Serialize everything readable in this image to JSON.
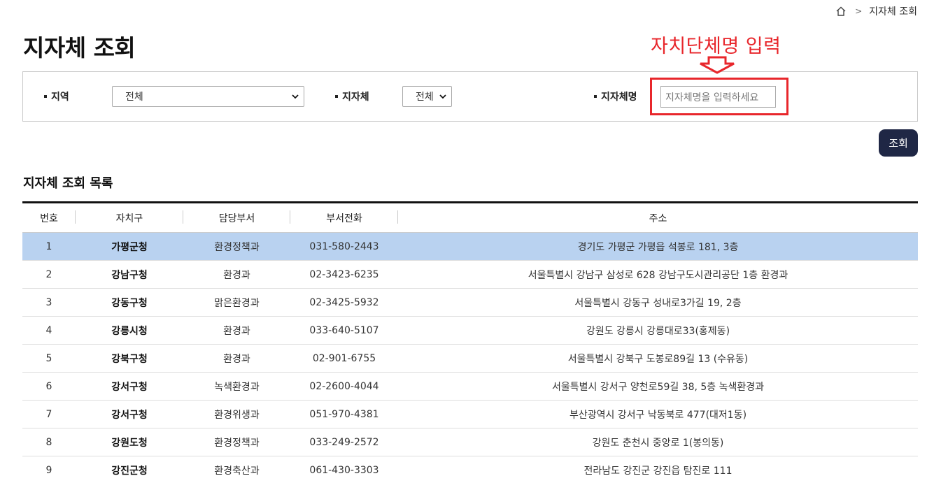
{
  "breadcrumb": {
    "home_icon": "home-icon",
    "separator": ">",
    "current": "지자체 조회"
  },
  "page": {
    "title": "지자체 조회"
  },
  "annotation": {
    "label": "자치단체명 입력",
    "color": "#e8262b"
  },
  "search": {
    "region_label": "지역",
    "region_value": "전체",
    "local_label": "지자체",
    "local_value": "전체",
    "name_label": "지자체명",
    "name_placeholder": "지자체명을 입력하세요",
    "button_label": "조회",
    "button_color": "#1f2745"
  },
  "list": {
    "title": "지자체 조회 목록",
    "headers": [
      "번호",
      "자치구",
      "담당부서",
      "부서전화",
      "주소"
    ],
    "selected_color": "#b9d2f0",
    "rows": [
      {
        "no": "1",
        "name": "가평군청",
        "dept": "환경정책과",
        "phone": "031-580-2443",
        "address": "경기도 가평군 가평읍 석봉로 181, 3층"
      },
      {
        "no": "2",
        "name": "강남구청",
        "dept": "환경과",
        "phone": "02-3423-6235",
        "address": "서울특별시 강남구 삼성로 628 강남구도시관리공단 1층 환경과"
      },
      {
        "no": "3",
        "name": "강동구청",
        "dept": "맑은환경과",
        "phone": "02-3425-5932",
        "address": "서울특별시 강동구 성내로3가길 19, 2층"
      },
      {
        "no": "4",
        "name": "강릉시청",
        "dept": "환경과",
        "phone": "033-640-5107",
        "address": "강원도 강릉시 강릉대로33(홍제동)"
      },
      {
        "no": "5",
        "name": "강북구청",
        "dept": "환경과",
        "phone": "02-901-6755",
        "address": "서울특별시 강북구 도봉로89길 13 (수유동)"
      },
      {
        "no": "6",
        "name": "강서구청",
        "dept": "녹색환경과",
        "phone": "02-2600-4044",
        "address": "서울특별시 강서구 양천로59길 38, 5층 녹색환경과"
      },
      {
        "no": "7",
        "name": "강서구청",
        "dept": "환경위생과",
        "phone": "051-970-4381",
        "address": "부산광역시 강서구 낙동북로 477(대저1동)"
      },
      {
        "no": "8",
        "name": "강원도청",
        "dept": "환경정책과",
        "phone": "033-249-2572",
        "address": "강원도 춘천시 중앙로 1(봉의동)"
      },
      {
        "no": "9",
        "name": "강진군청",
        "dept": "환경축산과",
        "phone": "061-430-3303",
        "address": "전라남도 강진군 강진읍 탐진로 111"
      }
    ]
  }
}
